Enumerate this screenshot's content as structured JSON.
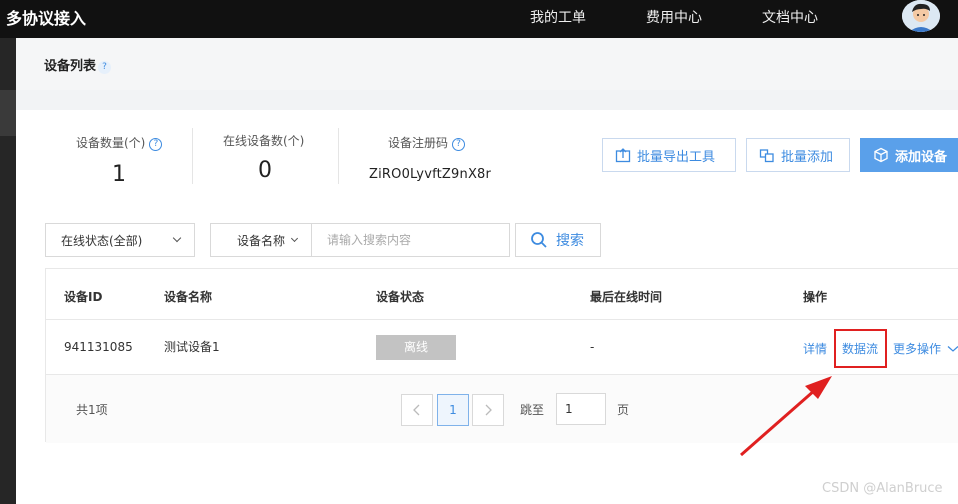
{
  "header": {
    "brand": "多协议接入",
    "nav": [
      "我的工单",
      "费用中心",
      "文档中心"
    ]
  },
  "page": {
    "title": "设备列表",
    "help_glyph": "?"
  },
  "stats": {
    "device_count_label": "设备数量(个)",
    "device_count_value": "1",
    "online_count_label": "在线设备数(个)",
    "online_count_value": "0",
    "register_code_label": "设备注册码",
    "register_code_value": "ZiRO0LyvftZ9nX8r"
  },
  "actions": {
    "batch_export": "批量导出工具",
    "batch_add": "批量添加",
    "add_device": "添加设备"
  },
  "filters": {
    "status_select": "在线状态(全部)",
    "field_select": "设备名称",
    "search_placeholder": "请输入搜索内容",
    "search_button": "搜索"
  },
  "table": {
    "columns": [
      "设备ID",
      "设备名称",
      "设备状态",
      "最后在线时间",
      "操作"
    ],
    "rows": [
      {
        "id": "941131085",
        "name": "测试设备1",
        "status": "离线",
        "last_online": "-",
        "ops": [
          "详情",
          "数据流",
          "更多操作"
        ]
      }
    ]
  },
  "pagination": {
    "total": "共1项",
    "current": "1",
    "jump_label": "跳至",
    "jump_value": "1",
    "page_unit": "页"
  },
  "watermark": "CSDN @AlanBruce",
  "colors": {
    "accent": "#3d8be0",
    "primary_button": "#5aa0ea",
    "highlight": "#e02020",
    "offline_badge": "#c3c3c3"
  }
}
